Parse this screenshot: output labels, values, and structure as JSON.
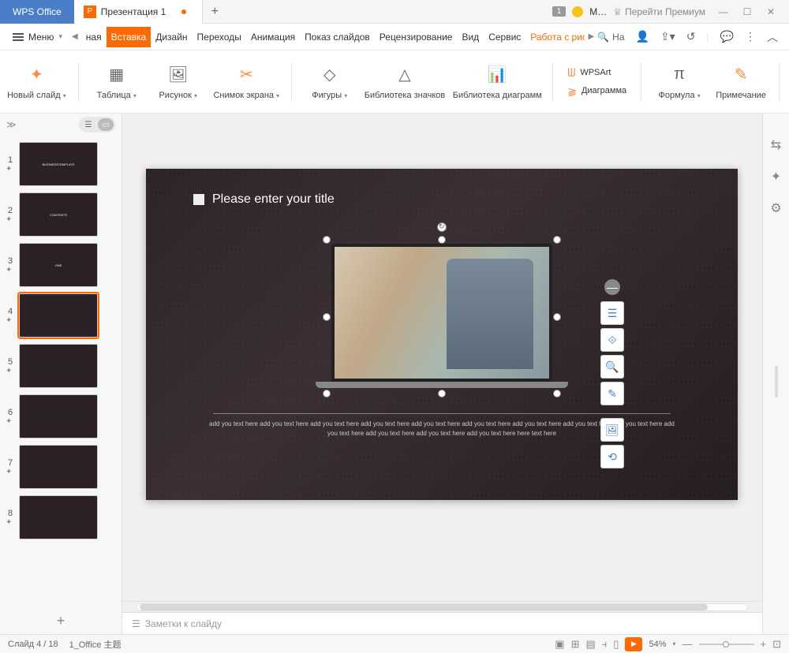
{
  "titlebar": {
    "app_name": "WPS Office",
    "doc_icon_letter": "P",
    "doc_name": "Презентация 1",
    "add_tab": "+",
    "num_badge": "1",
    "user_short": "М…",
    "premium_label": "Перейти Премиум"
  },
  "menubar": {
    "menu_label": "Меню",
    "tabs": [
      "ная",
      "Вставка",
      "Дизайн",
      "Переходы",
      "Анимация",
      "Показ слайдов",
      "Рецензирование",
      "Вид",
      "Сервис",
      "Работа с рис"
    ],
    "active_tab_index": 1,
    "orange_tab_index": 9,
    "search_label": "На"
  },
  "ribbon": {
    "items": [
      {
        "label": "Новый слайд",
        "dd": true,
        "accent": true
      },
      {
        "label": "Таблица",
        "dd": true
      },
      {
        "label": "Рисунок",
        "dd": true
      },
      {
        "label": "Снимок экрана",
        "dd": true,
        "accent": true
      },
      {
        "label": "Фигуры",
        "dd": true
      },
      {
        "label": "Библиотека значков"
      },
      {
        "label": "Библиотека диаграмм"
      },
      {
        "label": "WPSArt",
        "inline": true,
        "dd": false
      },
      {
        "label": "Диаграмма",
        "inline": true
      },
      {
        "label": "Формула",
        "dd": true
      },
      {
        "label": "Примечание",
        "accent": true
      }
    ]
  },
  "thumbs": {
    "count": 8,
    "selected": 4,
    "labels": [
      "BUSINESSTEMPLATE",
      "CONTENTS",
      "ONE",
      "",
      "",
      "",
      "",
      ""
    ]
  },
  "slide": {
    "title_placeholder": "Please enter your title",
    "body_text": "add you text here add you text here add you text here add you text here add you text here add you text here add you text here add you text here add you text here add you text here add you text here add you text here add you text here here text here"
  },
  "notes": {
    "placeholder": "Заметки к слайду"
  },
  "status": {
    "slide_counter": "Слайд 4 / 18",
    "theme": "1_Office 主题",
    "zoom": "54%"
  }
}
